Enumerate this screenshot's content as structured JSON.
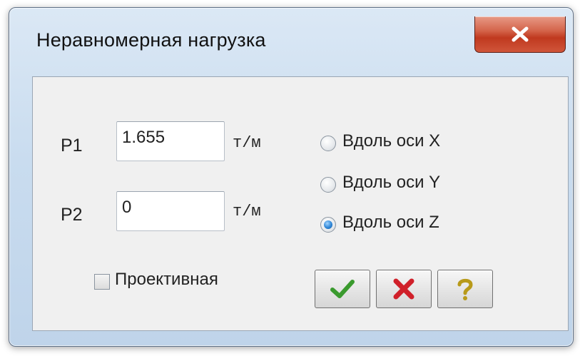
{
  "window": {
    "title": "Неравномерная нагрузка",
    "close_icon": "close-icon"
  },
  "p1": {
    "label": "P1",
    "value": "1.655",
    "unit": "т/м"
  },
  "p2": {
    "label": "P2",
    "value": "0",
    "unit": "т/м"
  },
  "direction": {
    "options": [
      {
        "label": "Вдоль оси X",
        "selected": false
      },
      {
        "label": "Вдоль оси Y",
        "selected": false
      },
      {
        "label": "Вдоль оси Z",
        "selected": true
      }
    ]
  },
  "projective": {
    "label": "Проективная",
    "checked": false
  },
  "buttons": {
    "ok_icon": "checkmark-icon",
    "cancel_icon": "cross-icon",
    "help_icon": "question-icon"
  },
  "colors": {
    "ok": "#3a9a2e",
    "cancel": "#d0202a",
    "help": "#b89a1a",
    "close_button": "#c7452b",
    "radio_selected": "#2f86d6"
  }
}
